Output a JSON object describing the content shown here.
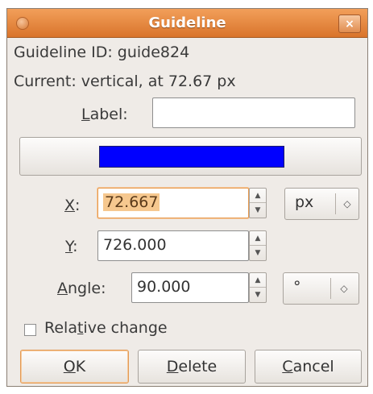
{
  "window": {
    "title": "Guideline",
    "close_glyph": "×"
  },
  "info": {
    "guideline_id": "Guideline ID: guide824",
    "current": "Current: vertical, at 72.67 px"
  },
  "label_field": {
    "label_mnemonic": "L",
    "label_rest": "abel:",
    "value": ""
  },
  "color": {
    "swatch": "#0000ff"
  },
  "x_field": {
    "label_mnemonic": "X",
    "label_rest": ":",
    "value": "72.667",
    "unit": "px"
  },
  "y_field": {
    "label_mnemonic": "Y",
    "label_rest": ":",
    "value": "726.000"
  },
  "angle_field": {
    "label_mnemonic": "A",
    "label_rest": "ngle:",
    "value": "90.000",
    "unit": "°"
  },
  "relative_change": {
    "label_before": "Rela",
    "label_mnemonic": "t",
    "label_after": "ive change",
    "checked": false
  },
  "buttons": {
    "ok": {
      "mnemonic": "O",
      "rest": "K"
    },
    "delete": {
      "mnemonic": "D",
      "rest": "elete"
    },
    "cancel": {
      "mnemonic": "C",
      "rest": "ancel"
    }
  },
  "icons": {
    "spin_up": "▲",
    "spin_down": "▼",
    "combo_arrows": "◇"
  }
}
